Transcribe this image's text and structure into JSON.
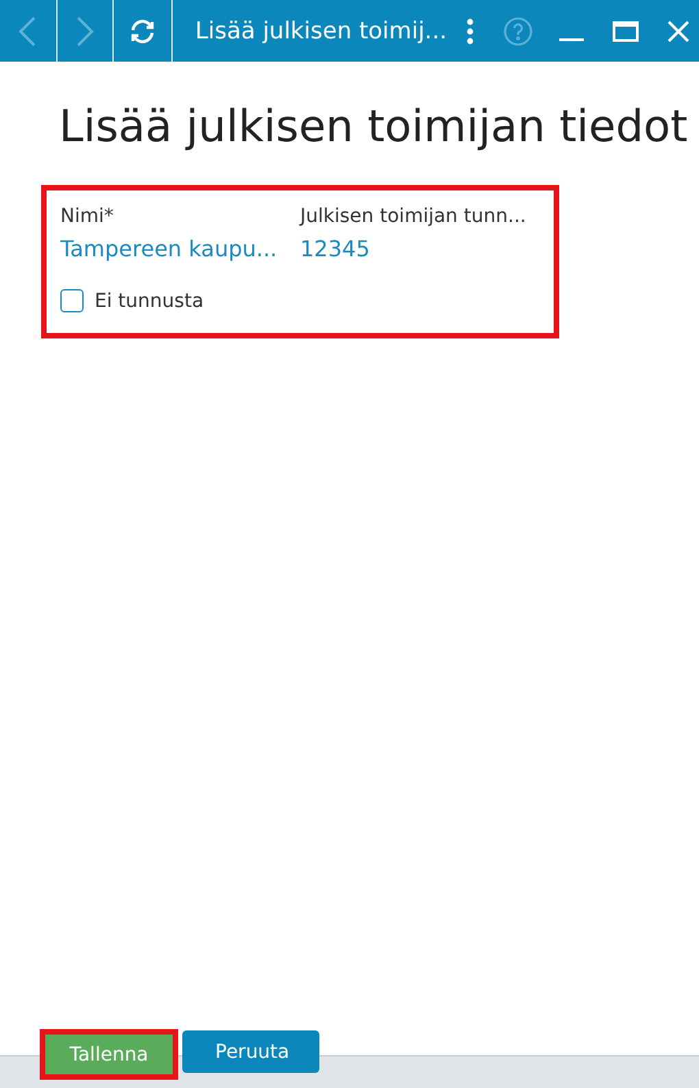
{
  "title_bar": {
    "title": "Lisää julkisen toimij...",
    "back_enabled": false,
    "forward_enabled": false,
    "help_enabled": false
  },
  "heading": "Lisää julkisen toimijan tiedot",
  "form": {
    "highlighted": true,
    "fields": [
      {
        "label": "Nimi*",
        "value": "Tampereen kaupu..."
      },
      {
        "label": "Julkisen toimijan tunn...",
        "value": "12345"
      }
    ],
    "checkbox": {
      "label": "Ei tunnusta",
      "checked": false
    }
  },
  "buttons": [
    {
      "label": "Tallenna",
      "kind": "primary",
      "highlighted": true
    },
    {
      "label": "Peruuta",
      "kind": "secondary",
      "highlighted": false
    }
  ]
}
